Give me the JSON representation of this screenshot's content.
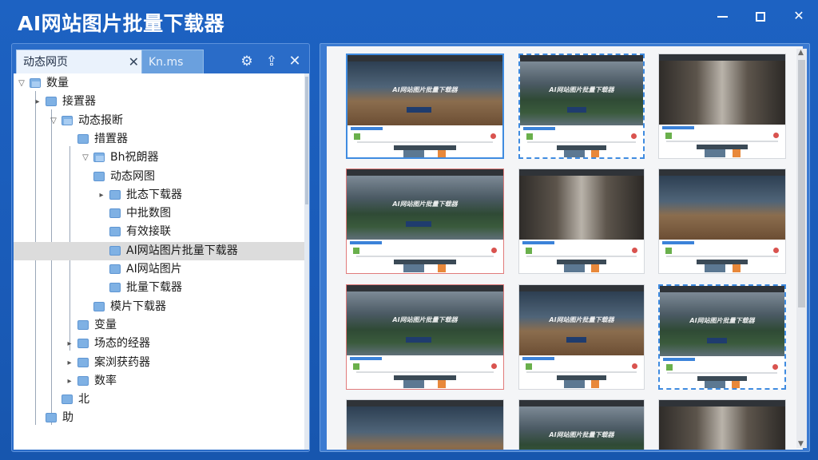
{
  "app": {
    "title": "AI网站图片批量下载器"
  },
  "window_controls": {
    "minimize": "—",
    "maximize": "□",
    "close": "✕"
  },
  "left_pane": {
    "tabs": [
      {
        "label": "动态网页",
        "active": true,
        "close": "✕"
      },
      {
        "label": "Kn.ms",
        "active": false
      }
    ],
    "tools": {
      "settings": "⚙",
      "export": "⇪",
      "close": "✕"
    },
    "tree": [
      {
        "label": "数量",
        "depth": 0,
        "toggle": "▽",
        "selected": false
      },
      {
        "label": "接置器",
        "depth": 1,
        "toggle": "▸",
        "selected": false
      },
      {
        "label": "动态报断",
        "depth": 2,
        "toggle": "▽",
        "selected": false
      },
      {
        "label": "措置器",
        "depth": 3,
        "toggle": "",
        "selected": false
      },
      {
        "label": "Bh祝朗器",
        "depth": 4,
        "toggle": "▽",
        "selected": false
      },
      {
        "label": "动态网图",
        "depth": 4,
        "toggle": "",
        "selected": false
      },
      {
        "label": "批态下载器",
        "depth": 5,
        "toggle": "▸",
        "selected": false
      },
      {
        "label": "中批数图",
        "depth": 5,
        "toggle": "",
        "selected": false
      },
      {
        "label": "有效接联",
        "depth": 5,
        "toggle": "",
        "selected": false
      },
      {
        "label": "AI网站图片批量下载器",
        "depth": 5,
        "toggle": "",
        "selected": true
      },
      {
        "label": "AI网站图片",
        "depth": 5,
        "toggle": "",
        "selected": false
      },
      {
        "label": "批量下载器",
        "depth": 5,
        "toggle": "",
        "selected": false
      },
      {
        "label": "模片下载器",
        "depth": 4,
        "toggle": "",
        "selected": false
      },
      {
        "label": "变量",
        "depth": 3,
        "toggle": "",
        "selected": false
      },
      {
        "label": "场态的经器",
        "depth": 3,
        "toggle": "▸",
        "selected": false
      },
      {
        "label": "案浏获药器",
        "depth": 3,
        "toggle": "▸",
        "selected": false
      },
      {
        "label": "数率",
        "depth": 3,
        "toggle": "▸",
        "selected": false
      },
      {
        "label": "北",
        "depth": 2,
        "toggle": "",
        "selected": false
      },
      {
        "label": "助",
        "depth": 1,
        "toggle": "",
        "selected": false
      }
    ]
  },
  "thumbnail_grid": {
    "cards": [
      {
        "image": "road",
        "caption": "AI网站图片批量下载器",
        "selection": "blue"
      },
      {
        "image": "mount",
        "caption": "AI网站图片批量下载器",
        "selection": "dash"
      },
      {
        "image": "city",
        "caption": "",
        "selection": "none"
      },
      {
        "image": "mount",
        "caption": "AI网站图片批量下载器",
        "selection": "red"
      },
      {
        "image": "city",
        "caption": "",
        "selection": "none"
      },
      {
        "image": "road",
        "caption": "",
        "selection": "none"
      },
      {
        "image": "mount",
        "caption": "AI网站图片批量下载器",
        "selection": "red"
      },
      {
        "image": "road",
        "caption": "AI网站图片批量下载器",
        "selection": "none"
      },
      {
        "image": "mount",
        "caption": "AI网站图片批量下载器",
        "selection": "dash"
      },
      {
        "image": "road",
        "caption": "",
        "selection": "none"
      },
      {
        "image": "mount",
        "caption": "AI网站图片批量下载器",
        "selection": "none"
      },
      {
        "image": "city",
        "caption": "",
        "selection": "none"
      }
    ]
  },
  "colors": {
    "accent": "#3f8be0",
    "title_bar": "#1d62c2",
    "selection_red": "#e07b7b"
  }
}
